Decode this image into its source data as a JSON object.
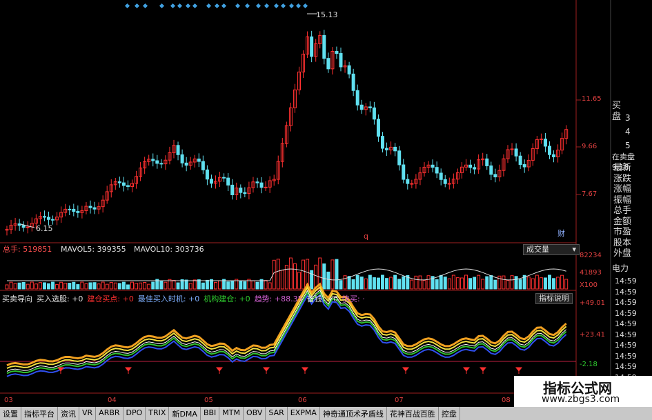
{
  "main_panel": {
    "price_high": "15.13",
    "price_low": "6.15",
    "axis_labels": [
      "11.65",
      "9.66",
      "7.67"
    ],
    "marker_q": "q",
    "marker_cai": "财"
  },
  "volume_panel": {
    "total_label": "总手: 519851",
    "mavol5": "MAVOL5: 399355",
    "mavol10": "MAVOL10: 303736",
    "dropdown": "成交量",
    "axis_labels": [
      "82234",
      "41893",
      "X100"
    ]
  },
  "indicator_panel": {
    "labels": [
      {
        "text": "买卖导向",
        "color": "#e0e0e0"
      },
      {
        "text": "买入选股: +0",
        "color": "#e0e0e0"
      },
      {
        "text": "建仓买点: +0",
        "color": "#ff3030"
      },
      {
        "text": "最佳买入时机: +0",
        "color": "#7fb0ff"
      },
      {
        "text": "机构建仓: +0",
        "color": "#30d030"
      },
      {
        "text": "趋势: +88.35",
        "color": "#d060d0"
      },
      {
        "text": "备钱: +0",
        "color": "#e0e0e0"
      },
      {
        "text": "快买: ·",
        "color": "#d060d0"
      }
    ],
    "button": "指标说明",
    "axis_labels": [
      "+49.01",
      "+23.41",
      "-2.18"
    ]
  },
  "date_labels": [
    "03",
    "04",
    "05",
    "06",
    "07",
    "08"
  ],
  "sidebar": {
    "buy_header": "买盘",
    "levels": [
      "3",
      "4",
      "5"
    ],
    "in_sell": "在卖盘 9.18",
    "fields": [
      "最新",
      "涨跌",
      "涨幅",
      "振幅",
      "总手",
      "金额",
      "市盈",
      "股本",
      "外盘"
    ],
    "dianli": "电力",
    "times": [
      "14:59",
      "14:59",
      "14:59",
      "14:59",
      "14:59",
      "14:59",
      "14:59",
      "14:59",
      "14:59",
      "14:59",
      "14:59"
    ]
  },
  "tabs": [
    "设置",
    "指标平台",
    "资讯",
    "VR",
    "ARBR",
    "DPO",
    "TRIX",
    "新DMA",
    "BBI",
    "MTM",
    "OBV",
    "SAR",
    "EXPMA",
    "神奇通顶术矛盾线",
    "花神百战百胜",
    "控盘"
  ],
  "watermark": {
    "title": "指标公式网",
    "url": "www.zbgs3.com"
  },
  "colors": {
    "up": "#ff3030",
    "down": "#60e0f0",
    "axis": "#a02020",
    "gold": "#f0a020",
    "yellow": "#f0e040",
    "green": "#30c030",
    "blue": "#3050f0"
  }
}
